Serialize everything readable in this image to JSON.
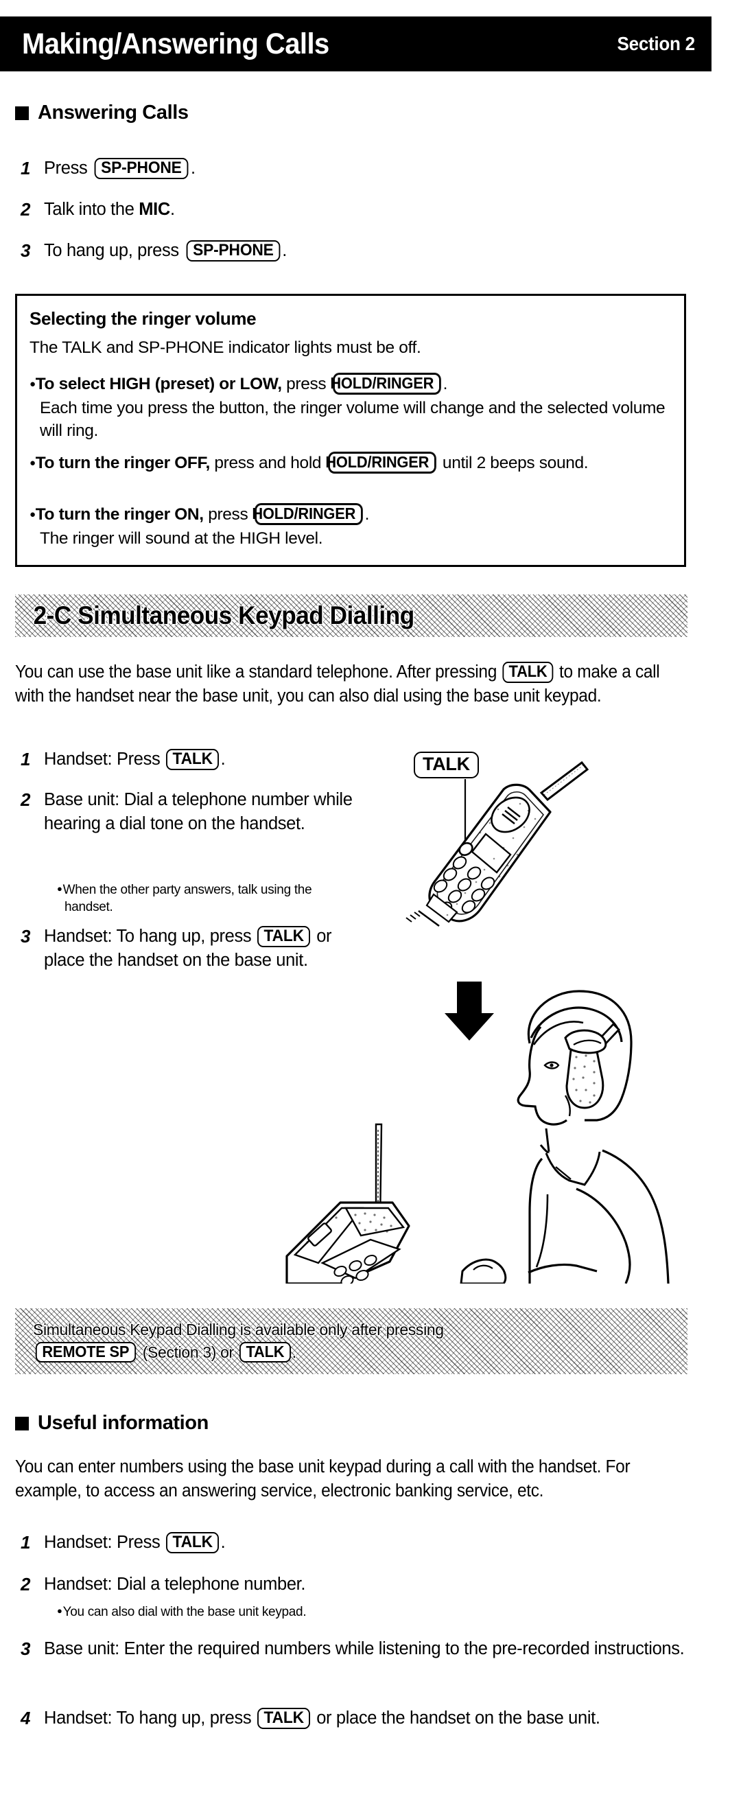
{
  "header": {
    "title": "Making/Answering Calls",
    "section": "Section 2"
  },
  "answering_calls": {
    "heading": "Answering Calls",
    "steps": [
      {
        "num": "1",
        "before": "Press ",
        "key": "SP-PHONE",
        "after": "."
      },
      {
        "num": "2",
        "before": "Talk into the ",
        "bold": "MIC",
        "after": "."
      },
      {
        "num": "3",
        "before": "To hang up, press ",
        "key": "SP-PHONE",
        "after": "."
      }
    ]
  },
  "ringer_box": {
    "title": "Selecting the ringer volume",
    "intro": "The TALK and SP-PHONE indicator lights must be off.",
    "items": [
      {
        "bold_lead": "To select HIGH (preset) or LOW,",
        "mid": " press ",
        "key": "HOLD/RINGER",
        "after": ".",
        "continuation": "Each time you press the button, the ringer volume will change and the selected volume will ring."
      },
      {
        "bold_lead": "To turn the ringer OFF,",
        "mid": " press and hold ",
        "key": "HOLD/RINGER",
        "after": " until 2 beeps sound.",
        "continuation": ""
      },
      {
        "bold_lead": "To turn the ringer ON,",
        "mid": " press ",
        "key": "HOLD/RINGER",
        "after": ".",
        "continuation": "The ringer will sound at the HIGH level."
      }
    ]
  },
  "section_2c": {
    "banner": "2-C Simultaneous Keypad Dialling",
    "intro_part1": "You can use the base unit like a standard telephone. After pressing ",
    "intro_key": "TALK",
    "intro_part2": " to make a call with the handset near the base unit, you can also dial using the base unit keypad.",
    "steps": [
      {
        "num": "1",
        "before": "Handset: Press ",
        "key": "TALK",
        "after": ".",
        "sub": ""
      },
      {
        "num": "2",
        "before": "Base unit: Dial a telephone number while hearing a dial tone on the handset.",
        "key": "",
        "after": "",
        "sub": "When the other party answers, talk using the handset."
      },
      {
        "num": "3",
        "before": "Handset: To hang up, press ",
        "key": "TALK",
        "after": " or place the handset on the base unit.",
        "sub": ""
      }
    ],
    "illustration": {
      "handset_callout": "TALK",
      "handset_alt": "cordless-handset-with-antenna",
      "arrow_alt": "down-arrow",
      "person_alt": "person-holding-handset-dialing-base-unit"
    },
    "note_band": {
      "line1_part1": "Simultaneous Keypad Dialling is available only after pressing",
      "line2_key1": "REMOTE SP",
      "line2_mid": " (Section 3) or ",
      "line2_key2": "TALK",
      "line2_after": "."
    }
  },
  "useful_information": {
    "heading": "Useful information",
    "intro": "You can enter numbers using the base unit keypad during a call with the handset. For example, to access an answering service, electronic banking service, etc.",
    "steps": [
      {
        "num": "1",
        "before": "Handset: Press ",
        "key": "TALK",
        "after": ".",
        "sub": ""
      },
      {
        "num": "2",
        "before": "Handset: Dial a telephone number.",
        "key": "",
        "after": "",
        "sub": "You can also dial with the base unit keypad."
      },
      {
        "num": "3",
        "before": "Base unit: Enter the required numbers while listening to the pre-recorded instructions.",
        "key": "",
        "after": "",
        "sub": ""
      },
      {
        "num": "4",
        "before": "Handset: To hang up, press ",
        "key": "TALK",
        "after": " or place the handset on the base unit.",
        "sub": ""
      }
    ]
  },
  "colors": {
    "ink": "#000000",
    "paper": "#ffffff"
  }
}
